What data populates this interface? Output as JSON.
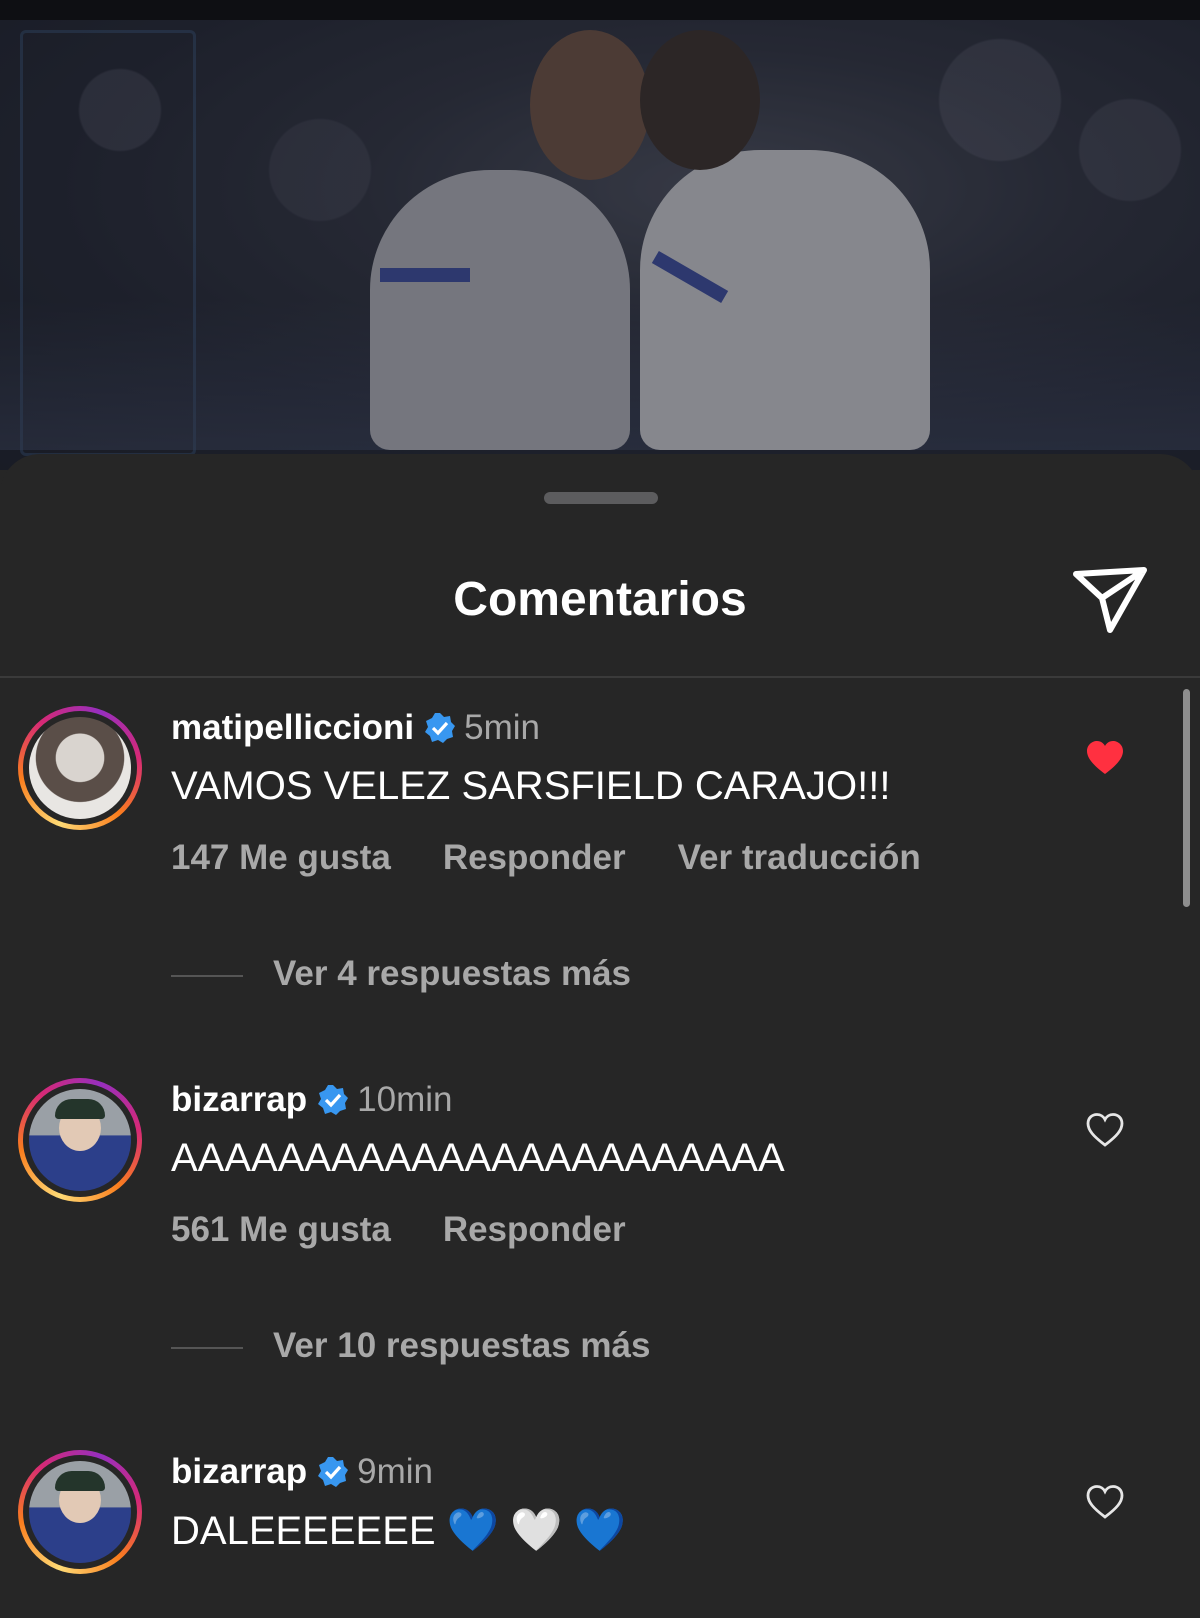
{
  "sheet": {
    "title": "Comentarios"
  },
  "comments": [
    {
      "username": "matipelliccioni",
      "verified": true,
      "time": "5min",
      "text": "VAMOS VELEZ SARSFIELD CARAJO!!!",
      "likes": "147 Me gusta",
      "reply": "Responder",
      "translate": "Ver traducción",
      "liked": true,
      "view_replies": "Ver 4 respuestas más"
    },
    {
      "username": "bizarrap",
      "verified": true,
      "time": "10min",
      "text": "AAAAAAAAAAAAAAAAAAAAAAA",
      "likes": "561 Me gusta",
      "reply": "Responder",
      "liked": false,
      "view_replies": "Ver 10 respuestas más"
    },
    {
      "username": "bizarrap",
      "verified": true,
      "time": "9min",
      "text": "DALEEEEEEE",
      "emojis": [
        "💙",
        "🤍",
        "💙"
      ],
      "liked": false
    }
  ],
  "colors": {
    "background": "#262626",
    "liked_heart": "#ff3040",
    "verified_badge": "#3897f0",
    "secondary_text": "#a8a8a8"
  },
  "icons": {
    "share": "paper-plane-icon",
    "like": "heart-icon",
    "verified": "verified-badge-icon"
  }
}
